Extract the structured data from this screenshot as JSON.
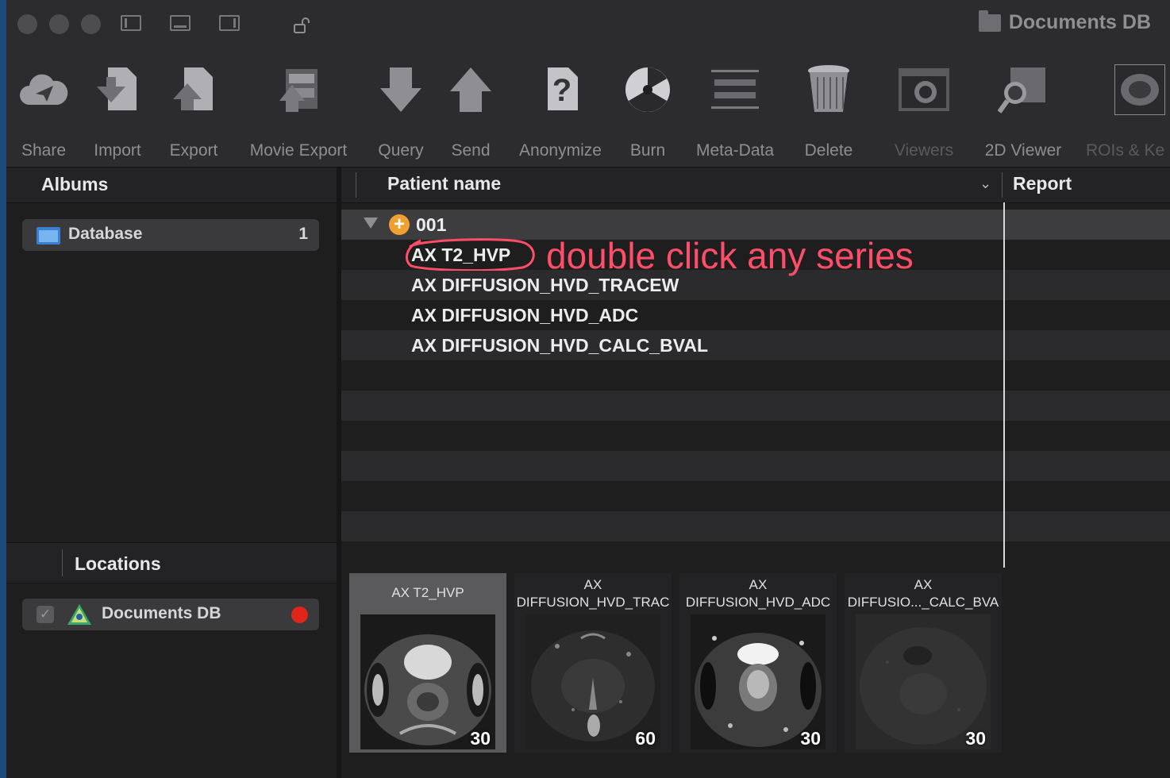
{
  "window": {
    "title": "Documents DB"
  },
  "toolbar": {
    "items": [
      {
        "label": "Share",
        "icon": "cloud-send-icon"
      },
      {
        "label": "Import",
        "icon": "import-icon"
      },
      {
        "label": "Export",
        "icon": "export-icon"
      },
      {
        "label": "Movie Export",
        "icon": "movie-export-icon"
      },
      {
        "label": "Query",
        "icon": "query-icon"
      },
      {
        "label": "Send",
        "icon": "send-icon"
      },
      {
        "label": "Anonymize",
        "icon": "anonymize-icon"
      },
      {
        "label": "Burn",
        "icon": "burn-icon"
      },
      {
        "label": "Meta-Data",
        "icon": "meta-data-icon"
      },
      {
        "label": "Delete",
        "icon": "trash-icon"
      },
      {
        "label": "Viewers",
        "icon": "viewers-icon"
      },
      {
        "label": "2D Viewer",
        "icon": "2d-viewer-icon"
      },
      {
        "label": "ROIs & Ke",
        "icon": "rois-icon"
      }
    ]
  },
  "sidebar": {
    "albums_title": "Albums",
    "albums": [
      {
        "name": "Database",
        "count": "1"
      }
    ],
    "locations_title": "Locations",
    "locations": [
      {
        "name": "Documents DB"
      }
    ]
  },
  "table": {
    "columns": {
      "patient_name": "Patient name",
      "report": "Report"
    },
    "patient": "001",
    "series": [
      "AX T2_HVP",
      "AX DIFFUSION_HVD_TRACEW",
      "AX DIFFUSION_HVD_ADC",
      "AX DIFFUSION_HVD_CALC_BVAL"
    ]
  },
  "annotation": {
    "text": "double click any series",
    "color": "#ff4d6a"
  },
  "thumbnails": [
    {
      "line1": "AX T2_HVP",
      "line2": "",
      "count": "30"
    },
    {
      "line1": "AX",
      "line2": "DIFFUSION_HVD_TRAC",
      "count": "60"
    },
    {
      "line1": "AX",
      "line2": "DIFFUSION_HVD_ADC",
      "count": "30"
    },
    {
      "line1": "AX",
      "line2": "DIFFUSIO..._CALC_BVA",
      "count": "30"
    }
  ]
}
